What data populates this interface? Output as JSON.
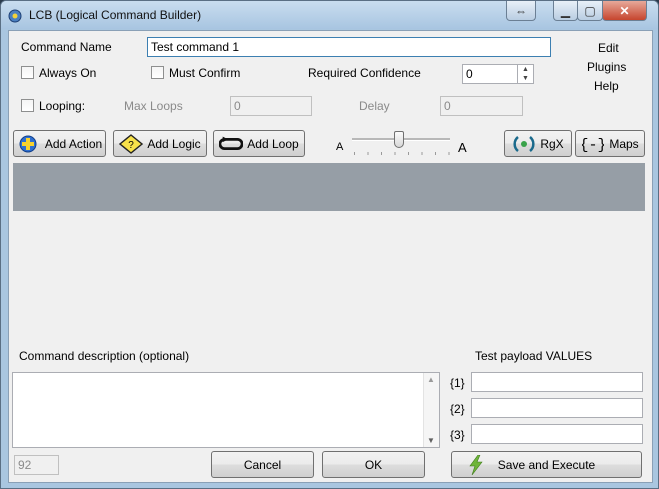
{
  "window": {
    "title": "LCB (Logical Command Builder)",
    "title_buttons": [
      "⇔",
      "▭",
      "▢",
      "✕"
    ]
  },
  "command": {
    "name_label": "Command Name",
    "name_value": "Test command 1",
    "always_on_label": "Always On",
    "must_confirm_label": "Must Confirm",
    "required_confidence_label": "Required Confidence",
    "required_confidence_value": "0",
    "looping_label": "Looping:",
    "max_loops_label": "Max Loops",
    "max_loops_value": "0",
    "delay_label": "Delay",
    "delay_value": "0"
  },
  "menu": {
    "edit": "Edit",
    "plugins": "Plugins",
    "help": "Help"
  },
  "toolbar": {
    "add_action": "Add Action",
    "add_logic": "Add Logic",
    "add_loop": "Add Loop",
    "slider_min_label": "A",
    "slider_max_label": "A",
    "rgx": "RgX",
    "maps": "Maps"
  },
  "description": {
    "label": "Command description (optional)",
    "char_count": "92"
  },
  "payload": {
    "label": "Test payload VALUES",
    "slots": [
      {
        "key": "{1}",
        "value": ""
      },
      {
        "key": "{2}",
        "value": ""
      },
      {
        "key": "{3}",
        "value": ""
      }
    ]
  },
  "footer": {
    "cancel": "Cancel",
    "ok": "OK",
    "save_execute": "Save and Execute"
  },
  "colors": {
    "titlebar": "#a8c5e1",
    "list_header": "#969ea6",
    "client_bg": "#f0f0f0"
  }
}
